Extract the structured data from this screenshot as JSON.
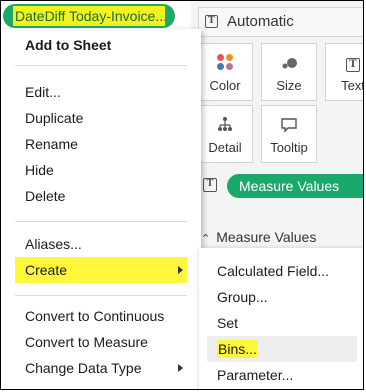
{
  "field_pill": {
    "label": "DateDiff Today-Invoice..."
  },
  "marks_card": {
    "mark_type": "Automatic",
    "buttons": [
      {
        "label": "Color",
        "icon": "color-icon"
      },
      {
        "label": "Size",
        "icon": "size-icon"
      },
      {
        "label": "Text",
        "icon": "text-icon"
      },
      {
        "label": "Detail",
        "icon": "detail-icon"
      },
      {
        "label": "Tooltip",
        "icon": "tooltip-icon"
      }
    ],
    "measure_pill": "Measure Values",
    "measure_values_header": "Measure Values"
  },
  "context_menu": {
    "add_to_sheet": "Add to Sheet",
    "edit": "Edit...",
    "duplicate": "Duplicate",
    "rename": "Rename",
    "hide": "Hide",
    "delete": "Delete",
    "aliases": "Aliases...",
    "create": "Create",
    "convert_continuous": "Convert to Continuous",
    "convert_measure": "Convert to Measure",
    "change_data_type": "Change Data Type"
  },
  "create_submenu": {
    "calculated_field": "Calculated Field...",
    "group": "Group...",
    "set": "Set",
    "bins": "Bins...",
    "parameter": "Parameter..."
  },
  "colors": {
    "highlight": "#fff83a",
    "pill_green": "#1ea86c",
    "measure_green": "#18a96b"
  }
}
